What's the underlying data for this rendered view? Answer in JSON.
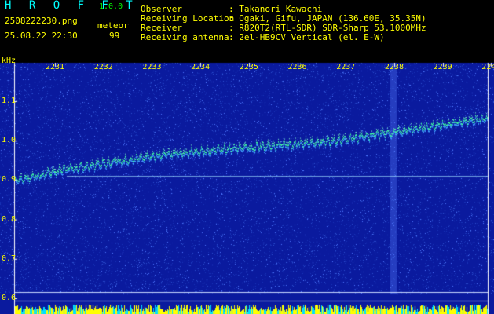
{
  "header": {
    "app_name": "H R O F F T",
    "version": "1.0.0",
    "filename": "2508222230.png",
    "datetime": "25.08.22 22:30",
    "count_label": "meteor",
    "count_value": "99",
    "info_labels": [
      "Observer",
      "Receiving Location",
      "Receiver",
      "Receiving antenna"
    ],
    "info_values": [
      ": Takanori Kawachi",
      ": Ogaki, Gifu, JAPAN (136.60E, 35.35N)",
      ": R820T2(RTL-SDR) SDR-Sharp 53.1000MHz",
      ": 2el-HB9CV Vertical (el. E-W)"
    ]
  },
  "chart_data": {
    "type": "heatmap",
    "ylabel": "kHz",
    "y_ticks": [
      "1.1",
      "1.0",
      "0.9",
      "0.8",
      "0.7",
      "0.6"
    ],
    "x_ticks": [
      "2231",
      "2232",
      "2233",
      "2234",
      "2235",
      "2236",
      "2237",
      "2238",
      "2239",
      "2240"
    ],
    "ylim": [
      0.58,
      1.18
    ],
    "carrier_khz": 0.91,
    "drift_trace_khz": [
      0.9,
      0.93,
      0.95,
      0.97,
      0.98,
      0.99,
      1.0,
      1.02,
      1.04,
      1.06
    ],
    "colors": {
      "background": "#0a1a9e",
      "noise": "#2d50d0",
      "trace": "#40ffa0",
      "line": "#a0e0ff"
    }
  }
}
